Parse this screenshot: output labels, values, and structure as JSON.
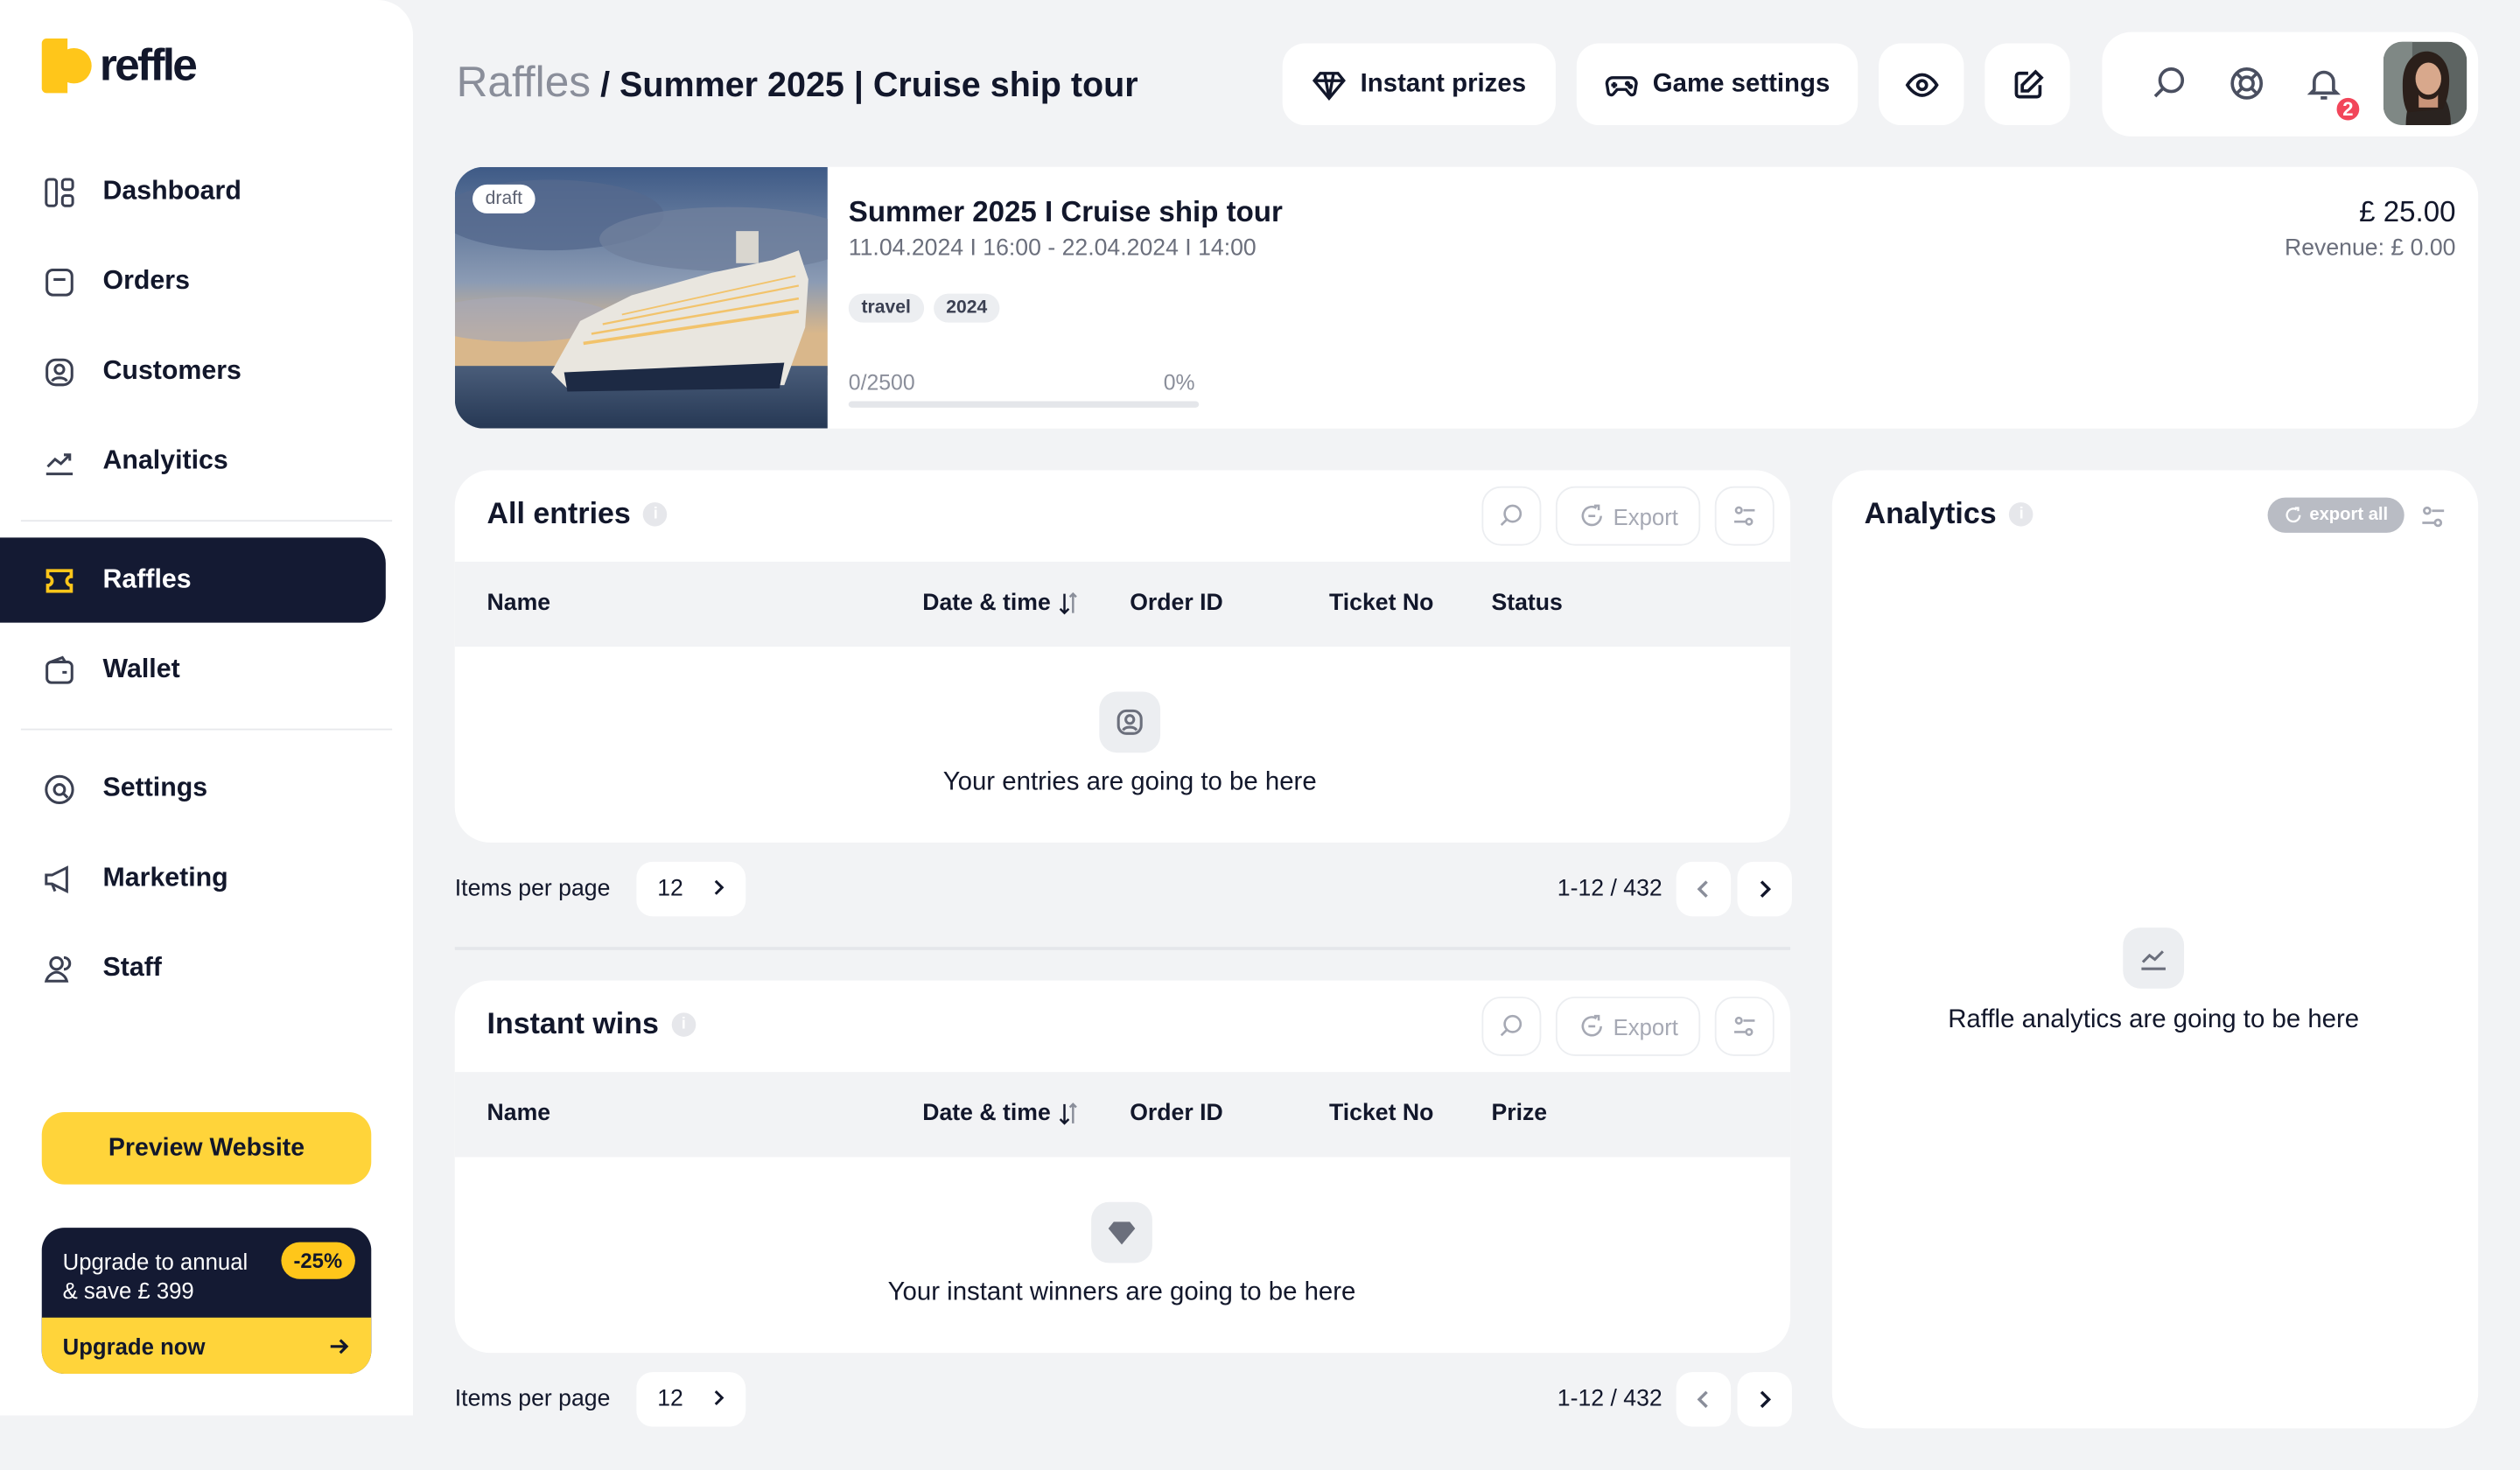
{
  "brand": {
    "logo_text": "reffle",
    "accent": "#ffc61a",
    "dark": "#141a33"
  },
  "sidebar": {
    "items": [
      {
        "label": "Dashboard",
        "icon": "dashboard-icon"
      },
      {
        "label": "Orders",
        "icon": "orders-icon"
      },
      {
        "label": "Customers",
        "icon": "customers-icon"
      },
      {
        "label": "Analyitics",
        "icon": "analytics-icon"
      },
      {
        "label": "Raffles",
        "icon": "ticket-icon",
        "active": true
      },
      {
        "label": "Wallet",
        "icon": "wallet-icon"
      },
      {
        "label": "Settings",
        "icon": "settings-icon"
      },
      {
        "label": "Marketing",
        "icon": "megaphone-icon"
      },
      {
        "label": "Staff",
        "icon": "staff-icon"
      }
    ],
    "preview_label": "Preview Website",
    "upgrade": {
      "line1": "Upgrade to annual",
      "line2": "& save £ 399",
      "discount": "-25%",
      "cta": "Upgrade now"
    }
  },
  "header": {
    "breadcrumb_root": "Raffles",
    "breadcrumb_current": "/ Summer 2025 | Cruise ship tour",
    "instant_prizes_label": "Instant prizes",
    "game_settings_label": "Game settings",
    "notification_count": "2"
  },
  "raffle": {
    "status": "draft",
    "title": "Summer 2025 I Cruise ship tour",
    "dates": "11.04.2024 I 16:00 - 22.04.2024 I 14:00",
    "tags": [
      "travel",
      "2024"
    ],
    "tickets": "0/2500",
    "percent": "0%",
    "progress_fraction": 0,
    "price": "£ 25.00",
    "revenue": "Revenue: £ 0.00"
  },
  "entries": {
    "title": "All entries",
    "export_label": "Export",
    "columns": [
      "Name",
      "Date & time",
      "Order ID",
      "Ticket No",
      "Status"
    ],
    "empty_text": "Your entries are going to be here",
    "items_per_page_label": "Items per page",
    "items_per_page": "12",
    "range": "1-12 / 432"
  },
  "instant_wins": {
    "title": "Instant wins",
    "export_label": "Export",
    "columns": [
      "Name",
      "Date & time",
      "Order ID",
      "Ticket No",
      "Prize"
    ],
    "empty_text": "Your instant winners are going to be here",
    "items_per_page_label": "Items per page",
    "items_per_page": "12",
    "range": "1-12 / 432"
  },
  "analytics": {
    "title": "Analytics",
    "export_all_label": "export all",
    "empty_text": "Raffle analytics are going to be here"
  }
}
